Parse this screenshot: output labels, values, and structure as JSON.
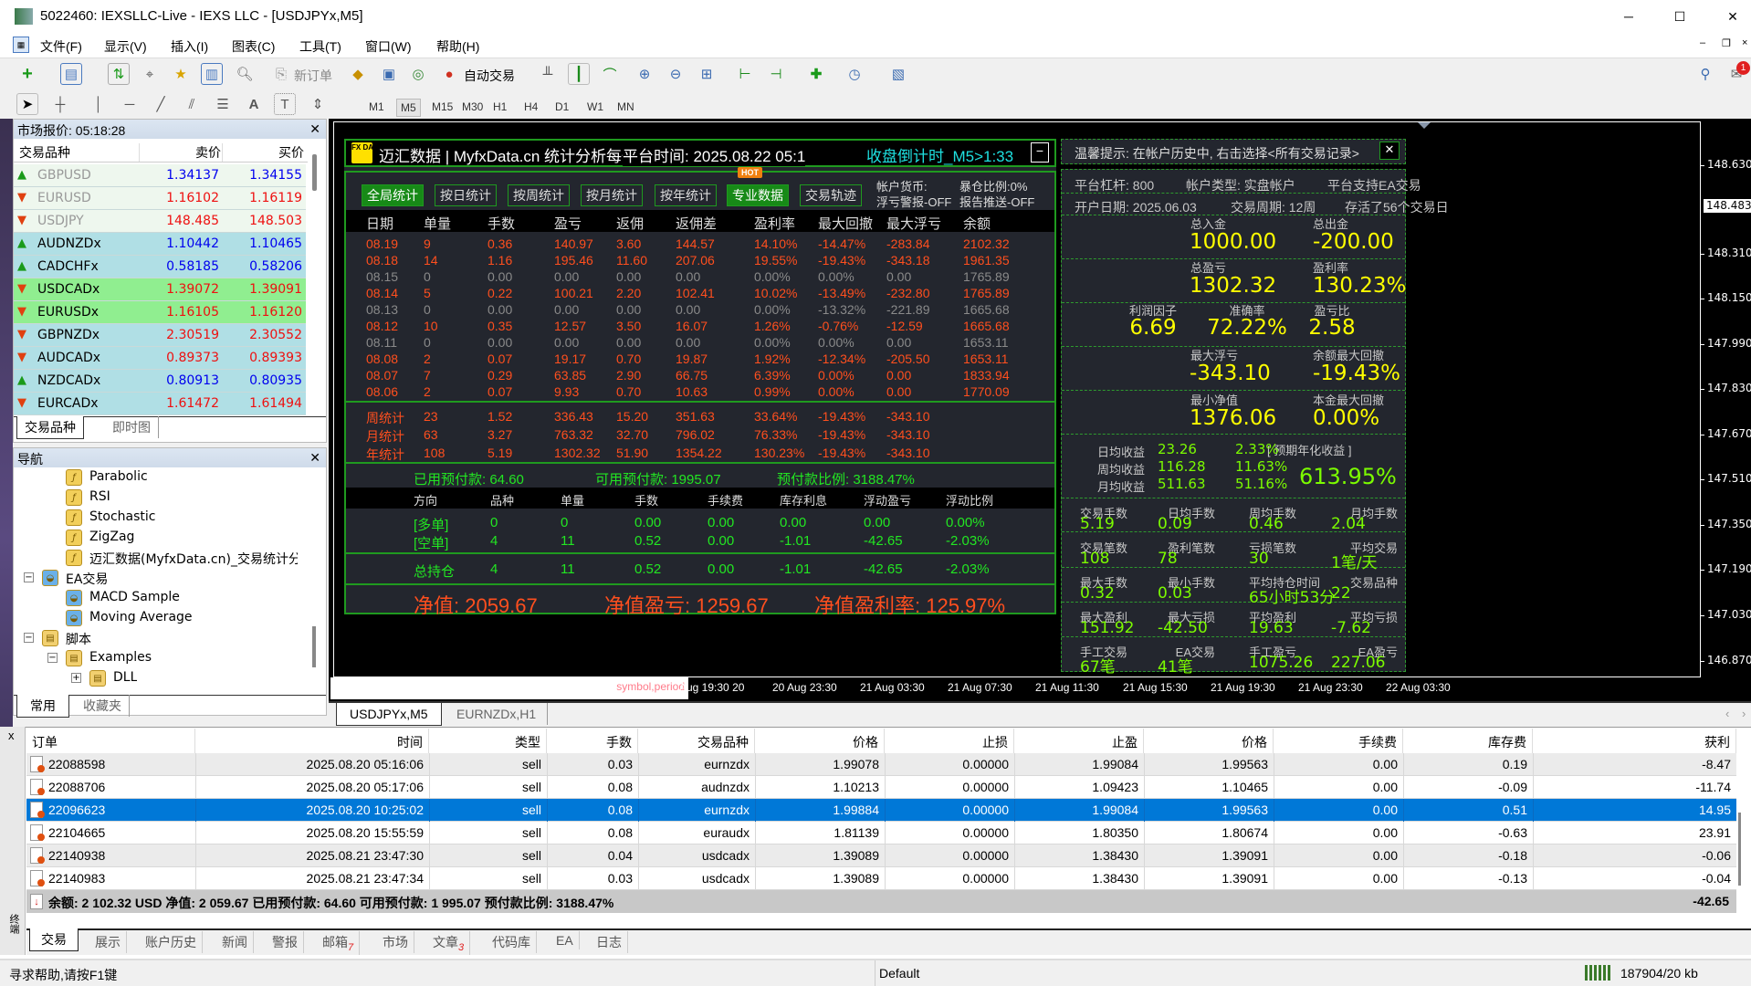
{
  "window": {
    "title": "5022460: IEXSLLC-Live - IEXS LLC - [USDJPYx,M5]"
  },
  "menu": [
    "文件(F)",
    "显示(V)",
    "插入(I)",
    "图表(C)",
    "工具(T)",
    "窗口(W)",
    "帮助(H)"
  ],
  "toolbar": {
    "new_order": "新订单",
    "auto_trade": "自动交易",
    "timeframes": [
      "M1",
      "M5",
      "M15",
      "M30",
      "H1",
      "H4",
      "D1",
      "W1",
      "MN"
    ],
    "active_tf": "M5",
    "notification_count": "1"
  },
  "market_watch": {
    "title": "市场报价: 05:18:28",
    "col_symbol": "交易品种",
    "col_bid": "卖价",
    "col_ask": "买价",
    "rows": [
      {
        "symbol": "GBPUSD",
        "bid": "1.34137",
        "ask": "1.34155",
        "dir": "up",
        "bg": "#eef7ee",
        "dim": true
      },
      {
        "symbol": "EURUSD",
        "bid": "1.16102",
        "ask": "1.16119",
        "dir": "down",
        "bg": "#eef7ee",
        "dim": true
      },
      {
        "symbol": "USDJPY",
        "bid": "148.485",
        "ask": "148.503",
        "dir": "down",
        "bg": "#eef7ee",
        "dim": true
      },
      {
        "symbol": "AUDNZDx",
        "bid": "1.10442",
        "ask": "1.10465",
        "dir": "up",
        "bg": "#b0dfe5"
      },
      {
        "symbol": "CADCHFx",
        "bid": "0.58185",
        "ask": "0.58206",
        "dir": "up",
        "bg": "#b0dfe5"
      },
      {
        "symbol": "USDCADx",
        "bid": "1.39072",
        "ask": "1.39091",
        "dir": "down",
        "bg": "#90ee90"
      },
      {
        "symbol": "EURUSDx",
        "bid": "1.16105",
        "ask": "1.16120",
        "dir": "down",
        "bg": "#90ee90"
      },
      {
        "symbol": "GBPNZDx",
        "bid": "2.30519",
        "ask": "2.30552",
        "dir": "down",
        "bg": "#b0dfe5"
      },
      {
        "symbol": "AUDCADx",
        "bid": "0.89373",
        "ask": "0.89393",
        "dir": "down",
        "bg": "#b0dfe5"
      },
      {
        "symbol": "NZDCADx",
        "bid": "0.80913",
        "ask": "0.80935",
        "dir": "up",
        "bg": "#b0dfe5"
      },
      {
        "symbol": "EURCADx",
        "bid": "1.61472",
        "ask": "1.61494",
        "dir": "down",
        "bg": "#b0dfe5"
      }
    ],
    "tabs": [
      "交易品种",
      "即时图"
    ]
  },
  "navigator": {
    "title": "导航",
    "items": [
      {
        "label": "Parabolic",
        "level": 3,
        "icon": "indicator"
      },
      {
        "label": "RSI",
        "level": 3,
        "icon": "indicator"
      },
      {
        "label": "Stochastic",
        "level": 3,
        "icon": "indicator"
      },
      {
        "label": "ZigZag",
        "level": 3,
        "icon": "indicator"
      },
      {
        "label": "迈汇数据(MyfxData.cn)_交易统计分",
        "level": 3,
        "icon": "indicator"
      },
      {
        "label": "EA交易",
        "level": 1,
        "icon": "expert",
        "toggle": "−"
      },
      {
        "label": "MACD Sample",
        "level": 2,
        "icon": "expert"
      },
      {
        "label": "Moving Average",
        "level": 2,
        "icon": "expert"
      },
      {
        "label": "脚本",
        "level": 1,
        "icon": "script",
        "toggle": "−"
      },
      {
        "label": "Examples",
        "level": 2,
        "icon": "script",
        "toggle": "−"
      },
      {
        "label": "DLL",
        "level": 3,
        "icon": "script",
        "toggle": "+"
      }
    ],
    "tabs": [
      "常用",
      "收藏夹"
    ]
  },
  "stats_panel": {
    "logo": "FX DATA",
    "title": "迈汇数据 | MyfxData.cn  统计分析每一笔交易",
    "server_time": "平台时间: 2025.08.22 05:1",
    "countdown": "收盘倒计时_M5>1:33",
    "minimize": "−",
    "buttons": [
      "全局统计",
      "按日统计",
      "按周统计",
      "按月统计",
      "按年统计",
      "专业数据",
      "交易轨迹"
    ],
    "hot": "HOT",
    "account_currency": "帐户货币:",
    "stopout_ratio": "暴仓比例:0%",
    "float_alert": "浮亏警报-OFF",
    "report_push": "报告推送-OFF",
    "columns": [
      "日期",
      "单量",
      "手数",
      "盈亏",
      "返佣",
      "返佣差",
      "盈利率",
      "最大回撤",
      "最大浮亏",
      "余额"
    ],
    "daily": [
      {
        "active": true,
        "v": [
          "08.19",
          "9",
          "0.36",
          "140.97",
          "3.60",
          "144.57",
          "14.10%",
          "-14.47%",
          "-283.84",
          "2102.32"
        ]
      },
      {
        "active": true,
        "v": [
          "08.18",
          "14",
          "1.16",
          "195.46",
          "11.60",
          "207.06",
          "19.55%",
          "-19.43%",
          "-343.18",
          "1961.35"
        ]
      },
      {
        "active": false,
        "v": [
          "08.15",
          "0",
          "0.00",
          "0.00",
          "0.00",
          "0.00",
          "0.00%",
          "0.00%",
          "0.00",
          "1765.89"
        ]
      },
      {
        "active": true,
        "v": [
          "08.14",
          "5",
          "0.22",
          "100.21",
          "2.20",
          "102.41",
          "10.02%",
          "-13.49%",
          "-232.80",
          "1765.89"
        ]
      },
      {
        "active": false,
        "v": [
          "08.13",
          "0",
          "0.00",
          "0.00",
          "0.00",
          "0.00",
          "0.00%",
          "-13.32%",
          "-221.89",
          "1665.68"
        ]
      },
      {
        "active": true,
        "v": [
          "08.12",
          "10",
          "0.35",
          "12.57",
          "3.50",
          "16.07",
          "1.26%",
          "-0.76%",
          "-12.59",
          "1665.68"
        ]
      },
      {
        "active": false,
        "v": [
          "08.11",
          "0",
          "0.00",
          "0.00",
          "0.00",
          "0.00",
          "0.00%",
          "0.00%",
          "0.00",
          "1653.11"
        ]
      },
      {
        "active": true,
        "v": [
          "08.08",
          "2",
          "0.07",
          "19.17",
          "0.70",
          "19.87",
          "1.92%",
          "-12.34%",
          "-205.50",
          "1653.11"
        ]
      },
      {
        "active": true,
        "v": [
          "08.07",
          "7",
          "0.29",
          "63.85",
          "2.90",
          "66.75",
          "6.39%",
          "0.00%",
          "0.00",
          "1833.94"
        ]
      },
      {
        "active": true,
        "v": [
          "08.06",
          "2",
          "0.07",
          "9.93",
          "0.70",
          "10.63",
          "0.99%",
          "0.00%",
          "0.00",
          "1770.09"
        ]
      }
    ],
    "summary": [
      [
        "周统计",
        "23",
        "1.52",
        "336.43",
        "15.20",
        "351.63",
        "33.64%",
        "-19.43%",
        "-343.10"
      ],
      [
        "月统计",
        "63",
        "3.27",
        "763.32",
        "32.70",
        "796.02",
        "76.33%",
        "-19.43%",
        "-343.10"
      ],
      [
        "年统计",
        "108",
        "5.19",
        "1302.32",
        "51.90",
        "1354.22",
        "130.23%",
        "-19.43%",
        "-343.10"
      ]
    ],
    "margin": {
      "used": "已用预付款: 64.60",
      "free": "可用预付款: 1995.07",
      "level": "预付款比例: 3188.47%"
    },
    "pos_columns": [
      "方向",
      "品种",
      "单量",
      "手数",
      "手续费",
      "库存利息",
      "浮动盈亏",
      "浮动比例"
    ],
    "positions": [
      [
        "[多单]",
        "0",
        "0",
        "0.00",
        "0.00",
        "0.00",
        "0.00",
        "0.00%"
      ],
      [
        "[空单]",
        "4",
        "11",
        "0.52",
        "0.00",
        "-1.01",
        "-42.65",
        "-2.03%"
      ]
    ],
    "total": [
      "总持仓",
      "4",
      "11",
      "0.52",
      "0.00",
      "-1.01",
      "-42.65",
      "-2.03%"
    ],
    "equity": "净值: 2059.67",
    "equity_pl": "净值盈亏: 1259.67",
    "equity_rate": "净值盈利率: 125.97%"
  },
  "info_panel": {
    "tip": "温馨提示: 在帐户历史中, 右击选择<所有交易记录>",
    "close": "✕",
    "leverage": "平台杠杆: 800",
    "account_type": "帐户类型: 实盘帐户",
    "ea_support": "平台支持EA交易",
    "open_date": "开户日期: 2025.06.03",
    "period": "交易周期: 12周",
    "alive": "存活了56个交易日",
    "metrics": [
      [
        {
          "label": "总入金",
          "value": "1000.00"
        },
        {
          "label": "总出金",
          "value": "-200.00"
        }
      ],
      [
        {
          "label": "总盈亏",
          "value": "1302.32"
        },
        {
          "label": "盈利率",
          "value": "130.23%"
        }
      ],
      [
        {
          "label": "利润因子",
          "value": "6.69"
        },
        {
          "label": "准确率",
          "value": "72.22%"
        },
        {
          "label": "盈亏比",
          "value": "2.58"
        }
      ],
      [
        {
          "label": "最大浮亏",
          "value": "-343.10"
        },
        {
          "label": "余额最大回撤",
          "value": "-19.43%"
        }
      ],
      [
        {
          "label": "最小净值",
          "value": "1376.06"
        },
        {
          "label": "本金最大回撤",
          "value": "0.00%"
        }
      ]
    ],
    "yields": [
      {
        "label": "日均收益",
        "value": "23.26",
        "pct": "2.33%"
      },
      {
        "label": "周均收益",
        "value": "116.28",
        "pct": "11.63%"
      },
      {
        "label": "月均收益",
        "value": "511.63",
        "pct": "51.16%"
      }
    ],
    "annual_label": "[ 预期年化收益 ]",
    "annual_value": "613.95%",
    "grid": [
      [
        [
          "交易手数",
          "5.19"
        ],
        [
          "日均手数",
          "0.09"
        ],
        [
          "周均手数",
          "0.46"
        ],
        [
          "月均手数",
          "2.04"
        ]
      ],
      [
        [
          "交易笔数",
          "108"
        ],
        [
          "盈利笔数",
          "78"
        ],
        [
          "亏损笔数",
          "30"
        ],
        [
          "平均交易",
          "1笔/天"
        ]
      ],
      [
        [
          "最大手数",
          "0.32"
        ],
        [
          "最小手数",
          "0.03"
        ],
        [
          "平均持仓时间",
          "65小时53分"
        ],
        [
          "交易品种",
          "22"
        ]
      ],
      [
        [
          "最大盈利",
          "151.92"
        ],
        [
          "最大亏损",
          "-42.50"
        ],
        [
          "平均盈利",
          "19.63"
        ],
        [
          "平均亏损",
          "-7.62"
        ]
      ],
      [
        [
          "手工交易",
          "67笔"
        ],
        [
          "EA交易",
          "41笔"
        ],
        [
          "手工盈亏",
          "1075.26"
        ],
        [
          "EA盈亏",
          "227.06"
        ]
      ]
    ]
  },
  "chart": {
    "symbol_label": "symbol,period",
    "current_price": "148.483",
    "price_ticks": [
      "148.630",
      "148.310",
      "148.150",
      "147.990",
      "147.830",
      "147.670",
      "147.510",
      "147.350",
      "147.190",
      "147.030",
      "146.870"
    ],
    "time_ticks": [
      "20 Aug 19:30",
      "20 Aug 23:30",
      "21 Aug 03:30",
      "21 Aug 07:30",
      "21 Aug 11:30",
      "21 Aug 15:30",
      "21 Aug 19:30",
      "21 Aug 23:30",
      "22 Aug 03:30"
    ],
    "tabs": [
      "USDJPYx,M5",
      "EURNZDx,H1"
    ]
  },
  "terminal": {
    "columns": [
      "订单",
      "时间",
      "类型",
      "手数",
      "交易品种",
      "价格",
      "止损",
      "止盈",
      "价格",
      "手续费",
      "库存费",
      "获利"
    ],
    "rows": [
      [
        "22088598",
        "2025.08.20 05:16:06",
        "sell",
        "0.03",
        "eurnzdx",
        "1.99078",
        "0.00000",
        "1.99084",
        "1.99563",
        "0.00",
        "0.19",
        "-8.47"
      ],
      [
        "22088706",
        "2025.08.20 05:17:06",
        "sell",
        "0.08",
        "audnzdx",
        "1.10213",
        "0.00000",
        "1.09423",
        "1.10465",
        "0.00",
        "-0.09",
        "-11.74"
      ],
      [
        "22096623",
        "2025.08.20 10:25:02",
        "sell",
        "0.08",
        "eurnzdx",
        "1.99884",
        "0.00000",
        "1.99084",
        "1.99563",
        "0.00",
        "0.51",
        "14.95"
      ],
      [
        "22104665",
        "2025.08.20 15:55:59",
        "sell",
        "0.08",
        "euraudx",
        "1.81139",
        "0.00000",
        "1.80350",
        "1.80674",
        "0.00",
        "-0.63",
        "23.91"
      ],
      [
        "22140938",
        "2025.08.21 23:47:30",
        "sell",
        "0.04",
        "usdcadx",
        "1.39089",
        "0.00000",
        "1.38430",
        "1.39091",
        "0.00",
        "-0.18",
        "-0.06"
      ],
      [
        "22140983",
        "2025.08.21 23:47:34",
        "sell",
        "0.03",
        "usdcadx",
        "1.39089",
        "0.00000",
        "1.38430",
        "1.39091",
        "0.00",
        "-0.13",
        "-0.04"
      ]
    ],
    "selected_index": 2,
    "summary": "余额: 2 102.32 USD  净值: 2 059.67  已用预付款: 64.60  可用预付款: 1 995.07  预付款比例: 3188.47%",
    "total_profit": "-42.65",
    "side_label": "终端",
    "tabs": [
      {
        "label": "交易"
      },
      {
        "label": "展示"
      },
      {
        "label": "账户历史"
      },
      {
        "label": "新闻"
      },
      {
        "label": "警报"
      },
      {
        "label": "邮箱",
        "badge": "7"
      },
      {
        "label": "市场"
      },
      {
        "label": "文章",
        "badge": "3"
      },
      {
        "label": "代码库"
      },
      {
        "label": "EA"
      },
      {
        "label": "日志"
      }
    ]
  },
  "status": {
    "help": "寻求帮助,请按F1键",
    "profile": "Default",
    "traffic": "187904/20 kb"
  },
  "colors": {
    "active": "#ff4f1e",
    "inactive": "#8a8a8a",
    "green": "#22e622",
    "yellow": "#ffff00",
    "lime": "#7cfc00",
    "selected": "#0078d7"
  }
}
